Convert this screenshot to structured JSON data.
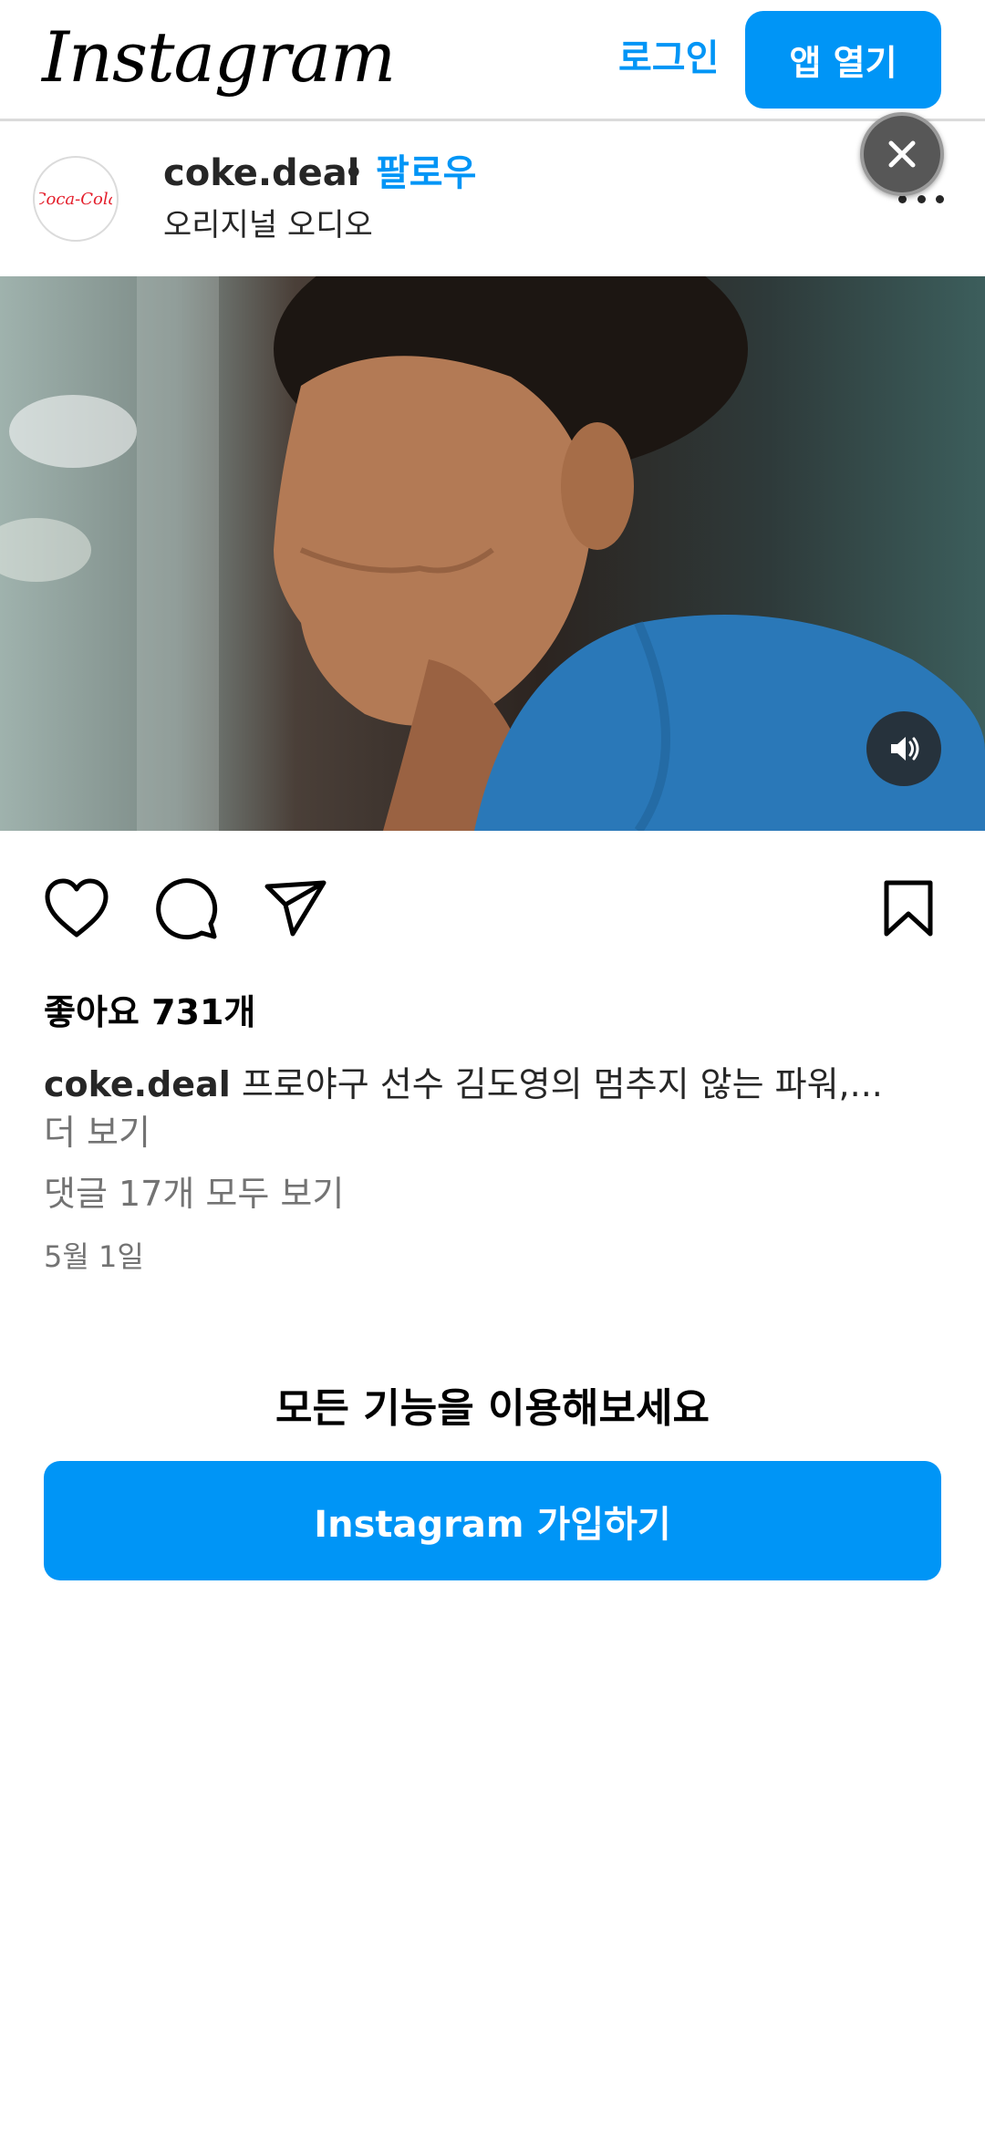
{
  "header": {
    "logo_text": "Instagram",
    "login_label": "로그인",
    "open_app_label": "앱 열기"
  },
  "post": {
    "username": "coke.deal",
    "separator": "•",
    "follow_label": "팔로우",
    "audio_label": "오리지널 오디오",
    "likes_text": "좋아요 731개",
    "caption_user": "coke.deal",
    "caption_text": "프로야구 선수 김도영의 멈추지 않는 파워,...",
    "more_label": "더 보기",
    "comments_text": "댓글 17개 모두 보기",
    "date_text": "5월 1일"
  },
  "cta": {
    "title": "모든 기능을 이용해보세요",
    "signup_label": "Instagram 가입하기"
  },
  "icons": {
    "avatar": "coca-cola-logo",
    "more": "more-options-icon",
    "close": "close-icon",
    "sound": "speaker-icon",
    "like": "heart-icon",
    "comment": "comment-icon",
    "share": "send-icon",
    "save": "bookmark-icon"
  },
  "colors": {
    "accent": "#0095f6",
    "secondary_text": "#737373",
    "avatar_brand": "#e41e2b"
  }
}
